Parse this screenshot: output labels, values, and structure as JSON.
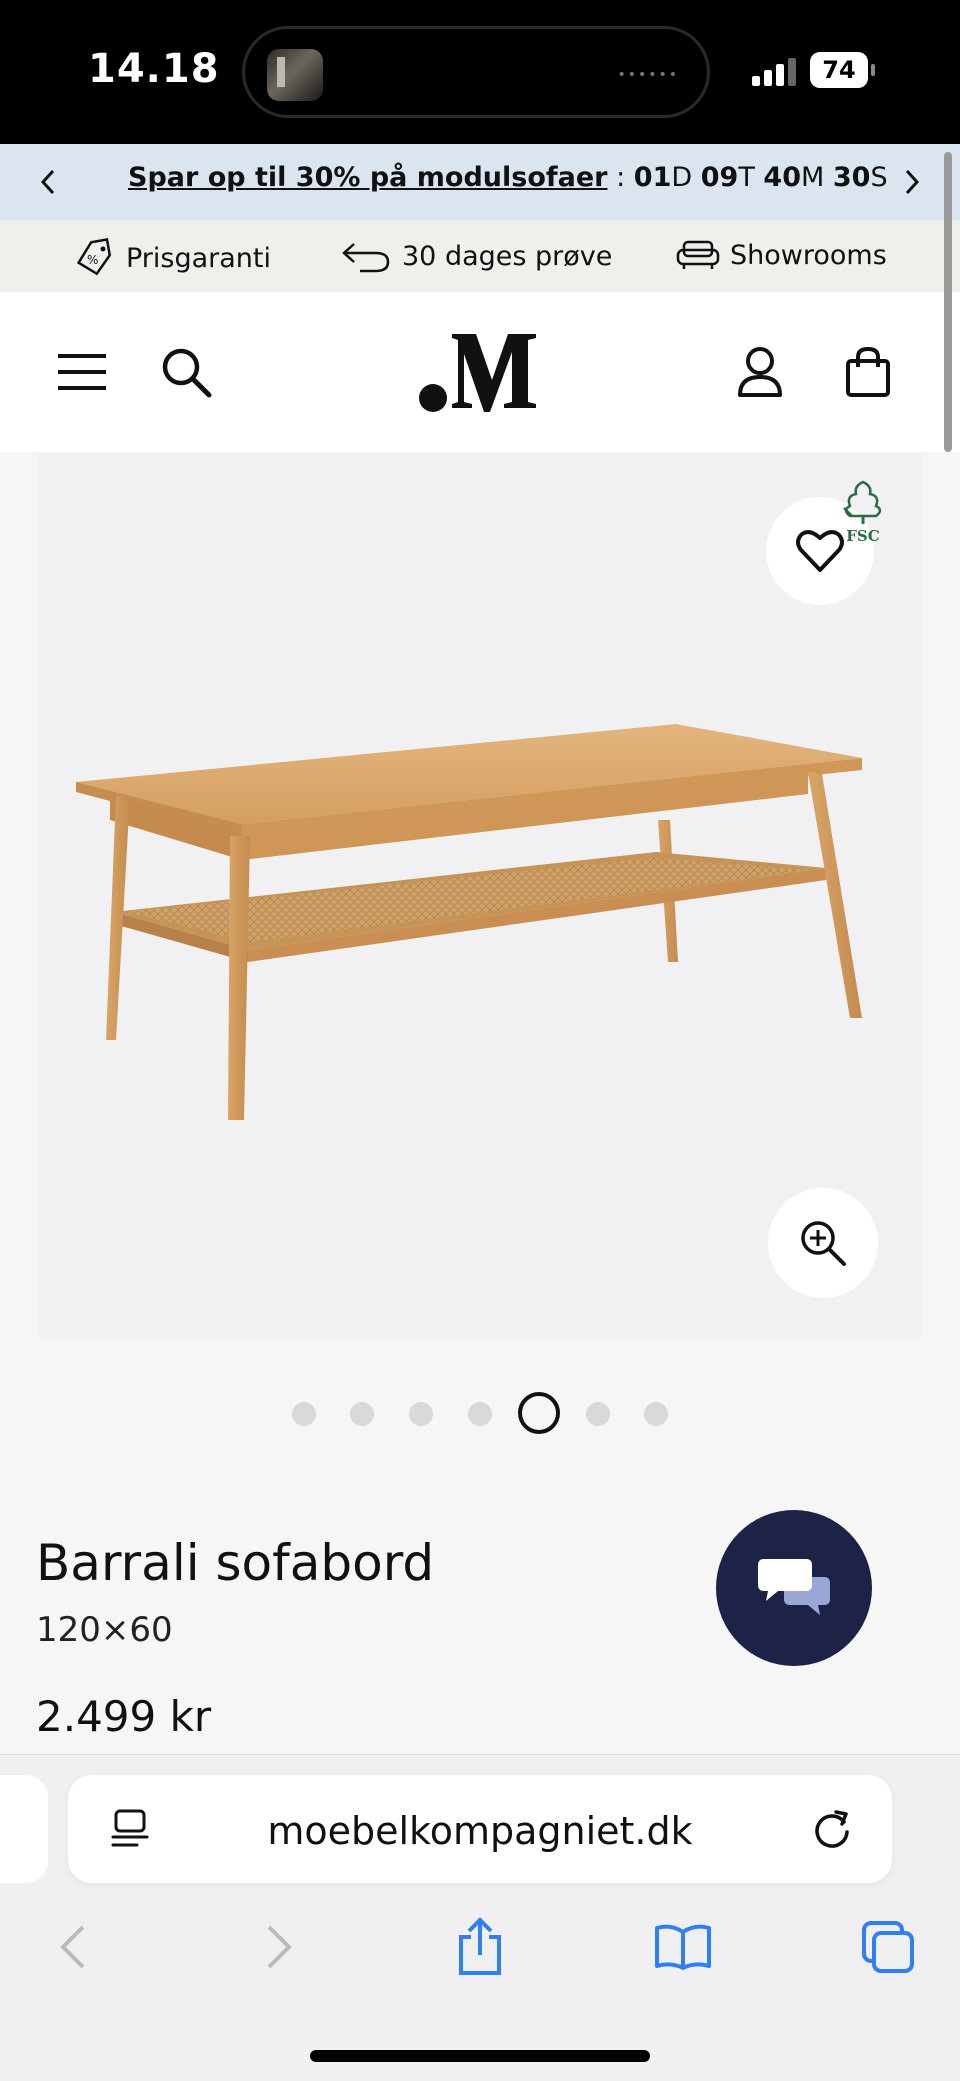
{
  "status_bar": {
    "time": "14.18",
    "battery": "74"
  },
  "promo": {
    "link_text": "Spar op til 30% på modulsofaer",
    "separator": ":",
    "countdown": [
      {
        "value": "01",
        "unit": "D"
      },
      {
        "value": "09",
        "unit": "T"
      },
      {
        "value": "40",
        "unit": "M"
      },
      {
        "value": "30",
        "unit": "S"
      }
    ]
  },
  "usp": [
    {
      "label": "Prisgaranti",
      "icon": "price-tag-icon"
    },
    {
      "label": "30 dages prøve",
      "icon": "return-arrow-icon"
    },
    {
      "label": "Showrooms",
      "icon": "sofa-icon"
    }
  ],
  "header": {
    "logo_icon": "brand-logo"
  },
  "product_image": {
    "badge_text": "FSC",
    "pager_count": 7,
    "pager_active_index": 4
  },
  "product": {
    "title": "Barrali sofabord",
    "size": "120×60",
    "price": "2.499 kr"
  },
  "browser": {
    "url": "moebelkompagniet.dk"
  },
  "colors": {
    "promo_bg": "#dbe5ef",
    "usp_bg": "#efefec",
    "chat_bg": "#1c2346",
    "safari_blue": "#2f7ff6"
  }
}
